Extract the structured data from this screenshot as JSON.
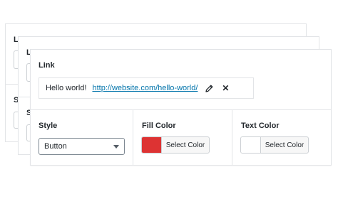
{
  "back_cards": {
    "back": {
      "top_letter": "L",
      "bottom_letter": "S"
    },
    "mid": {
      "top_letter": "L",
      "bottom_letter": "S"
    }
  },
  "link": {
    "label": "Link",
    "text": "Hello world!",
    "url": "http://website.com/hello-world/",
    "edit_icon": "pencil-icon",
    "remove_icon": "close-icon",
    "remove_glyph": "✕"
  },
  "style": {
    "label": "Style",
    "selected": "Button"
  },
  "fill_color": {
    "label": "Fill Color",
    "button_label": "Select Color",
    "swatch_color": "#dd3333"
  },
  "text_color": {
    "label": "Text Color",
    "button_label": "Select Color",
    "swatch_color": "#ffffff"
  },
  "colors": {
    "link": "#0073aa",
    "border": "#e2e4e7",
    "text": "#23282d"
  }
}
